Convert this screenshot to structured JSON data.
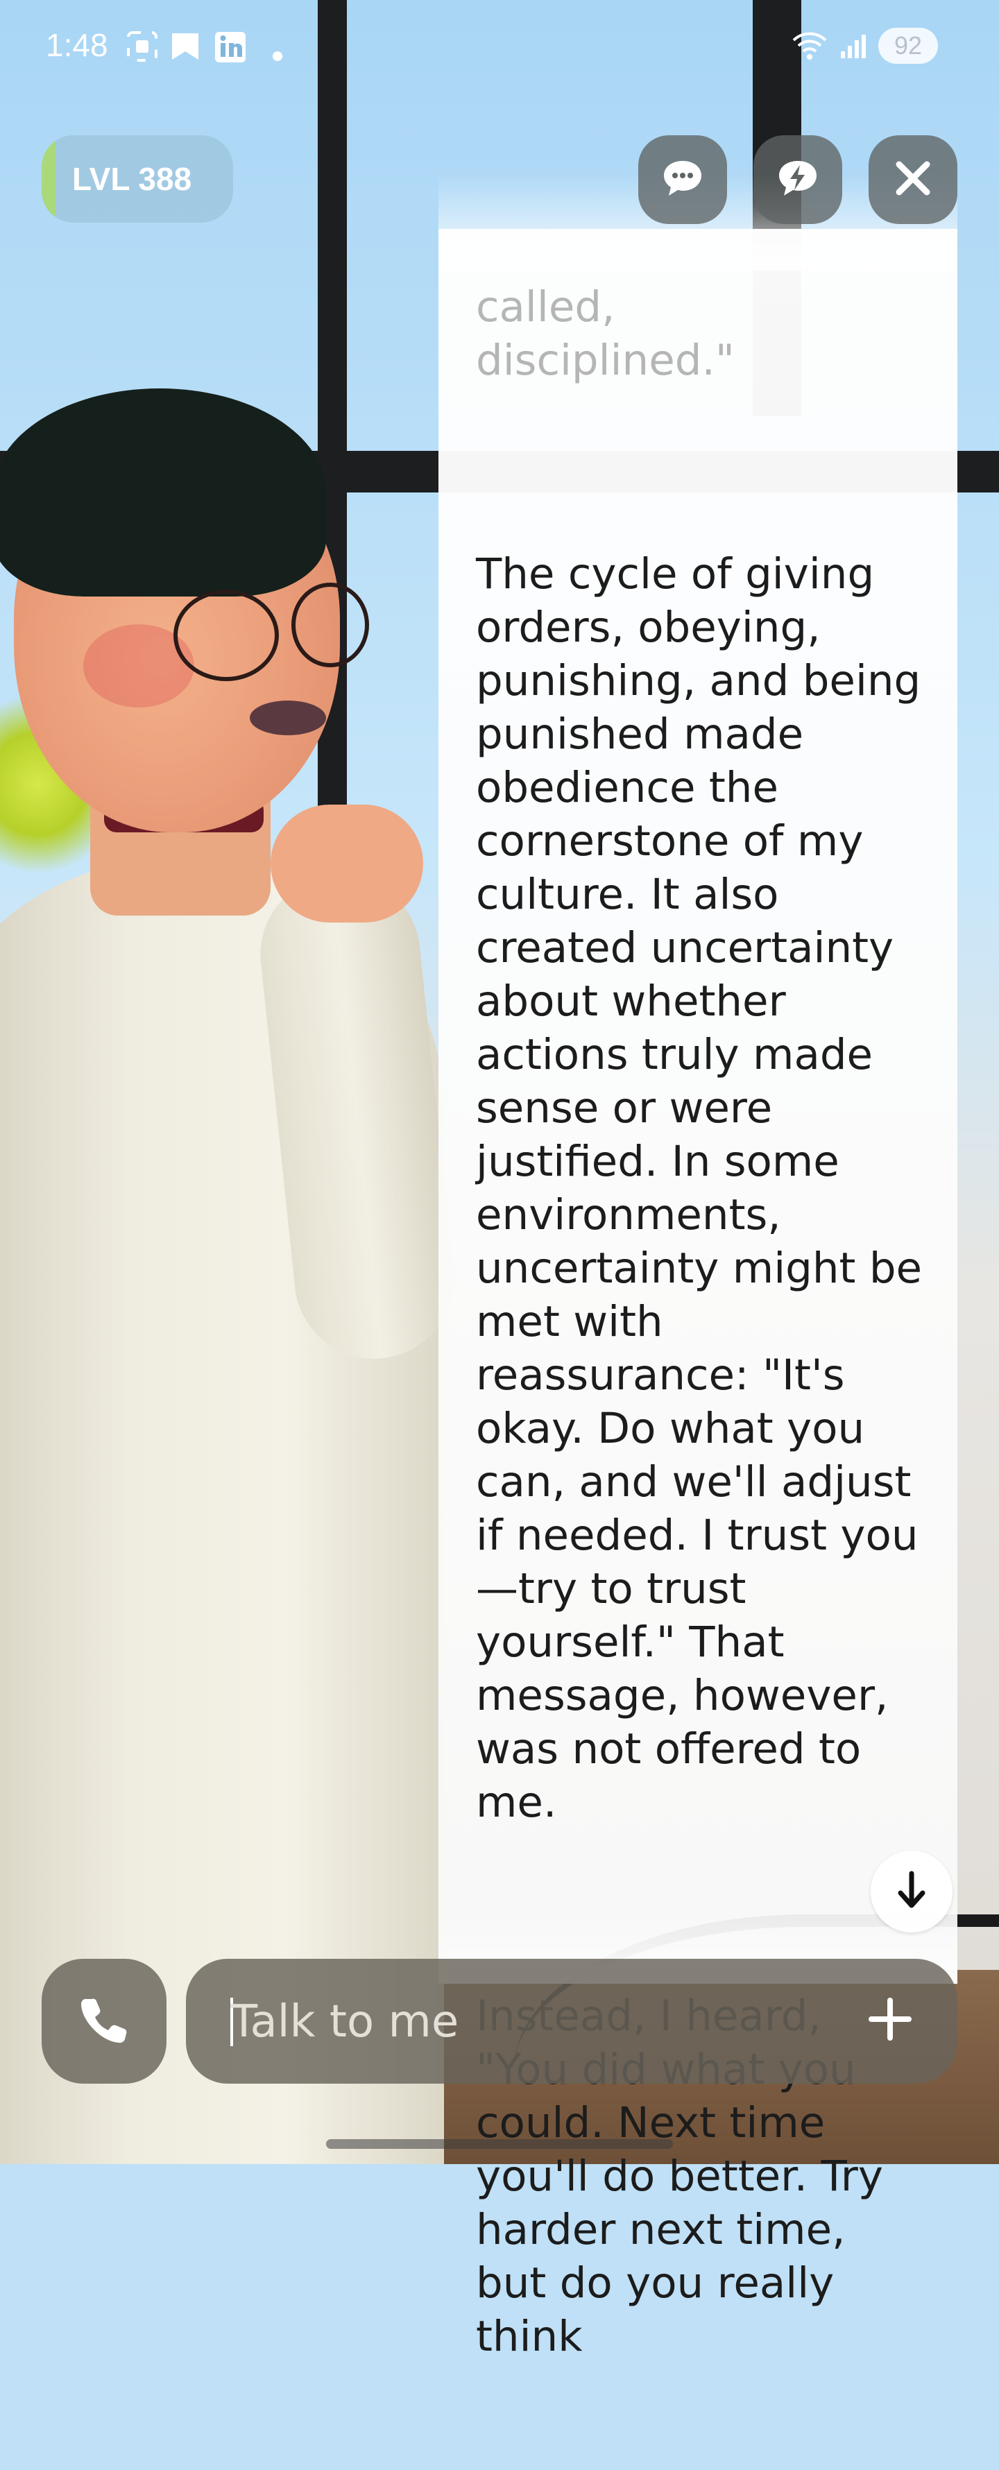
{
  "status_bar": {
    "time": "1:48",
    "battery": "92",
    "icons": [
      "screenshot-icon",
      "bookmark-icon",
      "linkedin-icon",
      "dot-icon",
      "wifi-icon",
      "signal-icon"
    ]
  },
  "level": {
    "label": "LVL 388"
  },
  "header_buttons": {
    "chat": "chat-bubble-icon",
    "quick": "lightning-bubble-icon",
    "close": "close-icon"
  },
  "message": {
    "faded_line_1": "called,",
    "faded_line_2": "disciplined.\"",
    "paragraph_1": "The cycle of giving orders, obeying, punishing, and being punished made obedience the cornerstone of my culture. It also created uncertainty about whether actions truly made sense or were justified. In some environments, uncertainty might be met with reassurance: \"It's okay. Do what you can, and we'll adjust if needed. I trust you—try to trust yourself.\" That message, however, was not offered to me.",
    "paragraph_2": "Instead, I heard, \"You did what you could. Next time you'll do better. Try harder next time, but do you really think"
  },
  "input": {
    "placeholder": "Talk to me",
    "value": ""
  },
  "colors": {
    "panel_bg": "#ffffff",
    "control_bg": "#5f6464",
    "input_bg": "#69645a",
    "level_accent": "#a9d97a"
  }
}
